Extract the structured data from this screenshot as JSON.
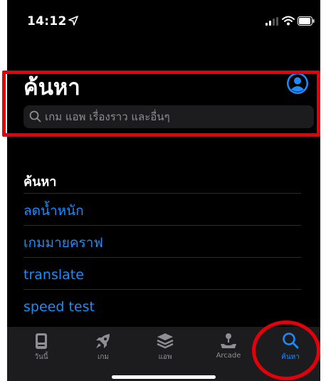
{
  "status_bar": {
    "time": "14:12"
  },
  "header": {
    "title": "ค้นหา",
    "search_placeholder": "เกม แอพ เรื่องราว และอื่นๆ"
  },
  "recent": {
    "title": "ค้นหา",
    "items": [
      "ลดน้ำหนัก",
      "เกมมายคราฟ",
      "translate",
      "speed test"
    ]
  },
  "tab_bar": {
    "tabs": [
      {
        "label": "วันนี้",
        "icon": "today-icon"
      },
      {
        "label": "เกม",
        "icon": "rocket-icon"
      },
      {
        "label": "แอพ",
        "icon": "layers-icon"
      },
      {
        "label": "Arcade",
        "icon": "joystick-icon"
      },
      {
        "label": "ค้นหา",
        "icon": "search-icon",
        "active": true
      }
    ]
  },
  "colors": {
    "accent": "#1a8cff",
    "highlight": "#e3000b",
    "background": "#000000"
  }
}
